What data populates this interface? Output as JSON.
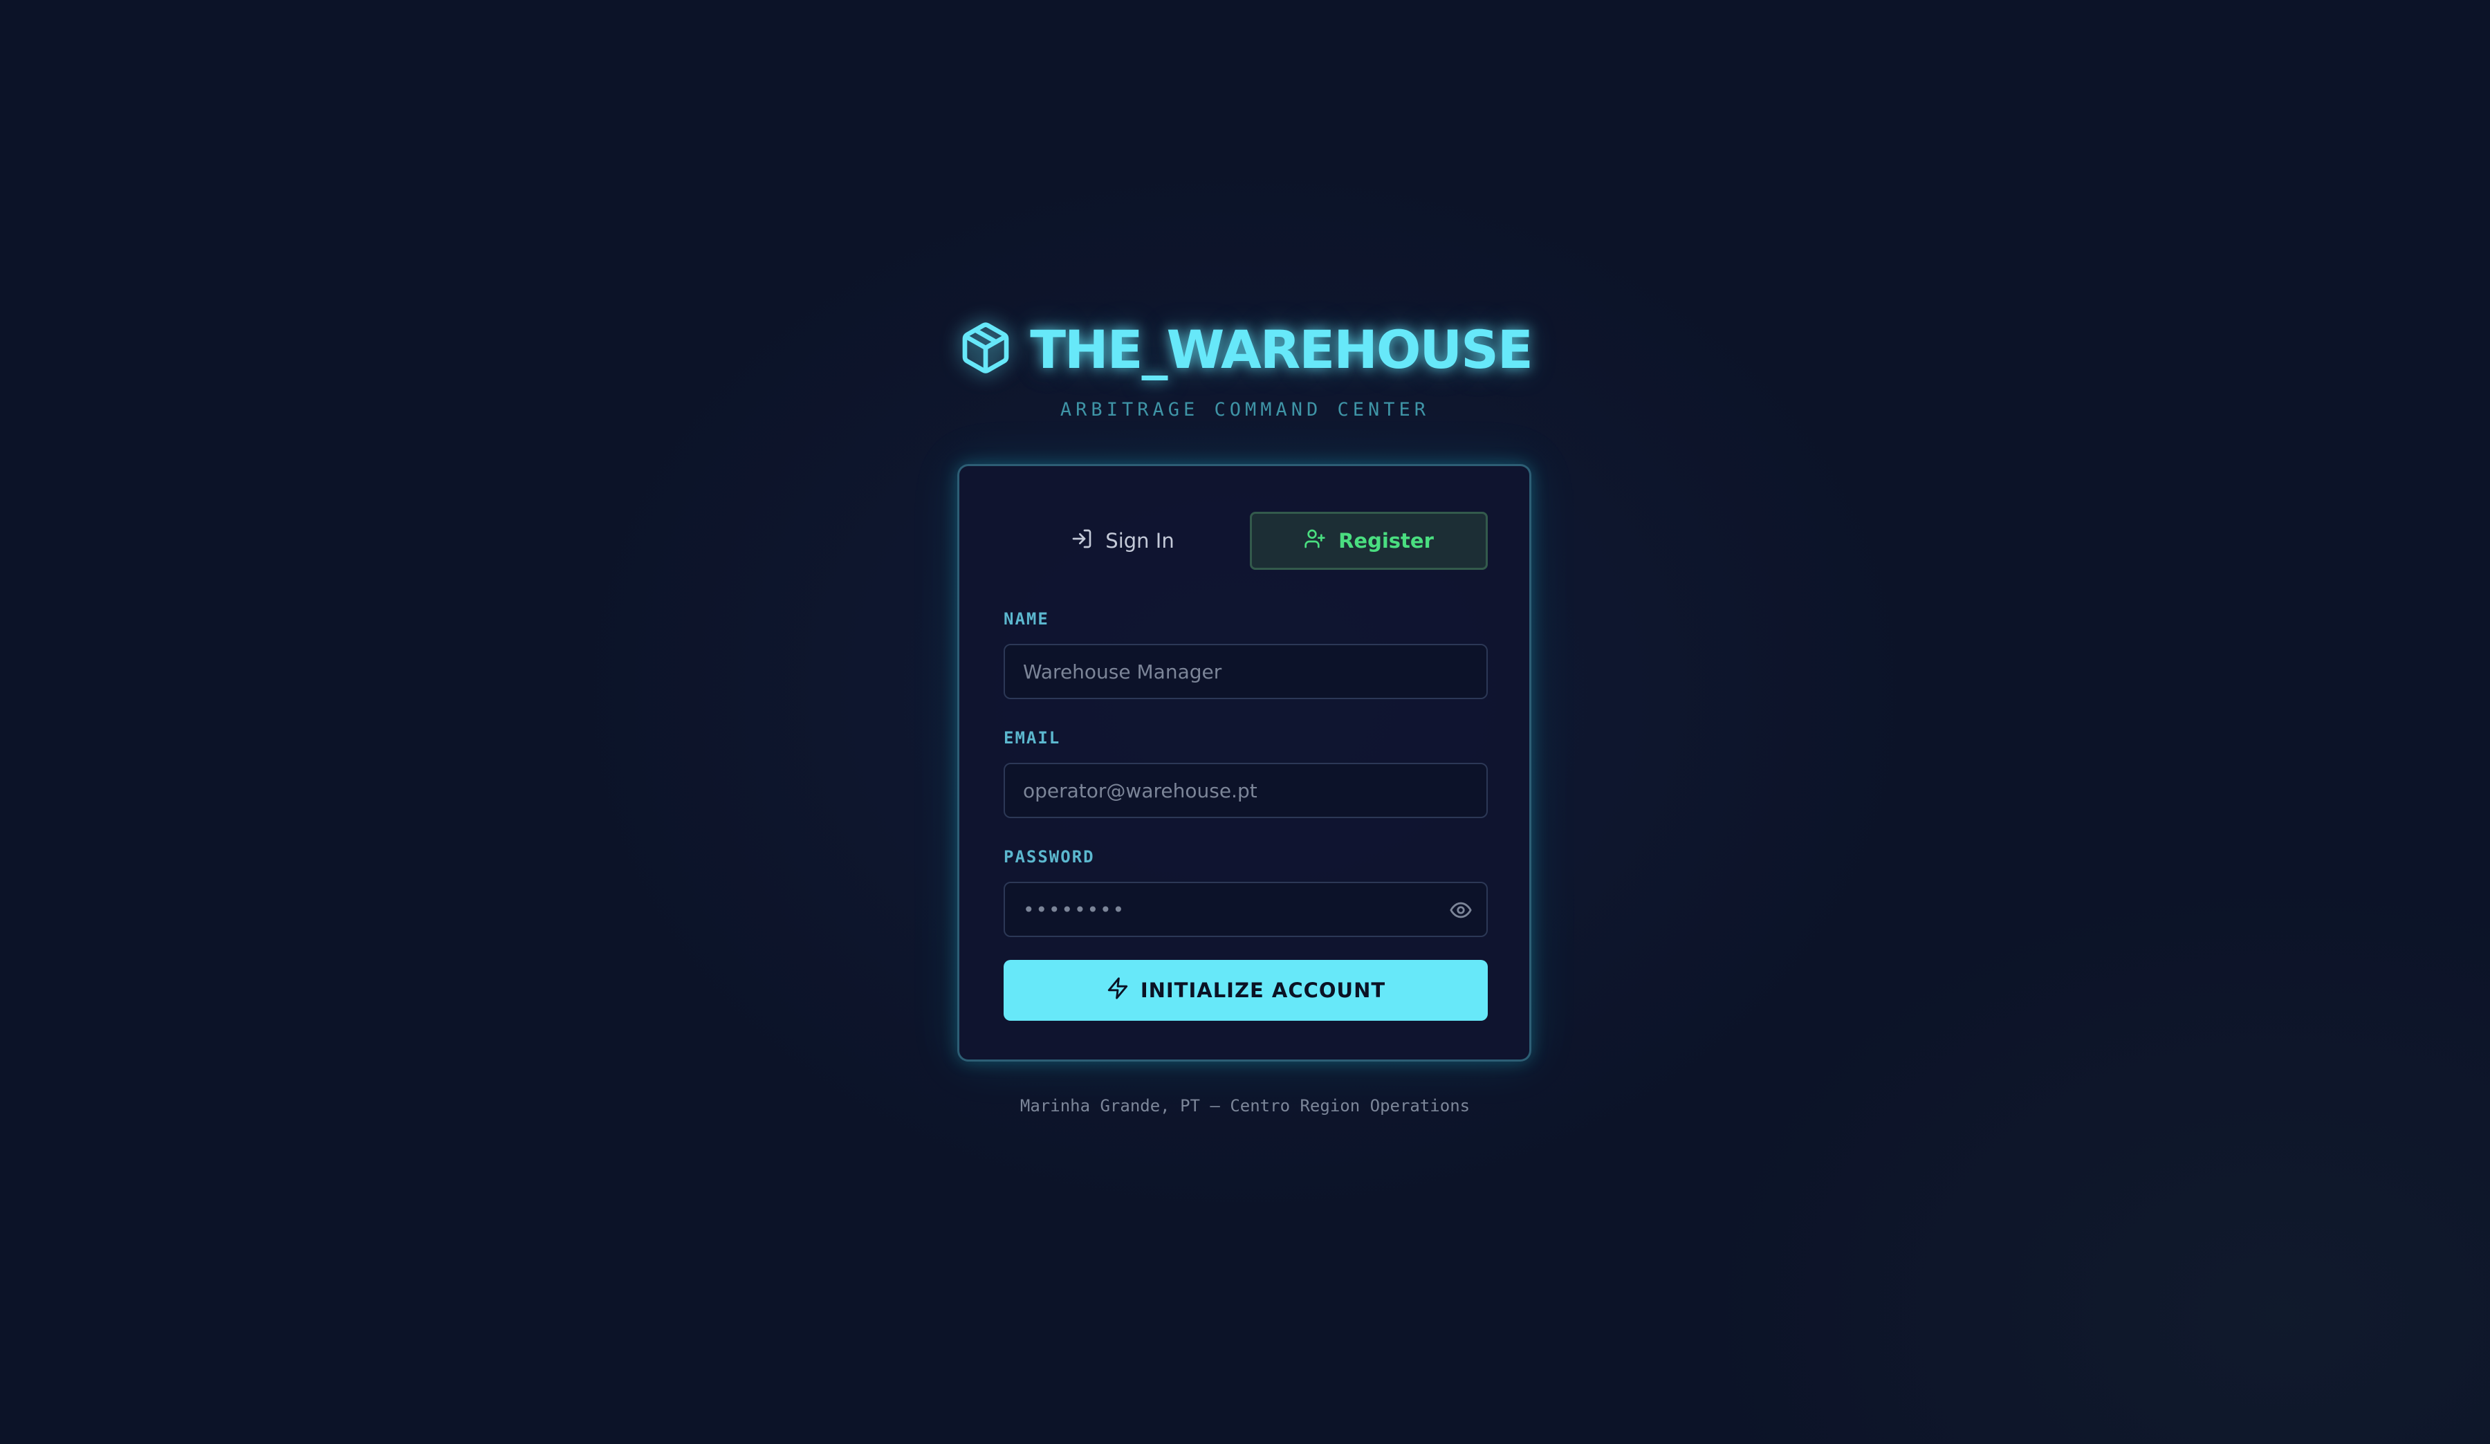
{
  "app": {
    "title": "THE_WAREHOUSE",
    "subtitle": "ARBITRAGE COMMAND CENTER",
    "logo_icon": "package-icon",
    "accent_color": "#67e8f9"
  },
  "auth": {
    "tabs": [
      {
        "label": "Sign In",
        "icon": "log-in-icon",
        "active": false
      },
      {
        "label": "Register",
        "icon": "user-plus-icon",
        "active": true,
        "color": "#4ade80"
      }
    ],
    "fields": {
      "name": {
        "label": "NAME",
        "placeholder": "Warehouse Manager",
        "value": ""
      },
      "email": {
        "label": "EMAIL",
        "placeholder": "operator@warehouse.pt",
        "value": ""
      },
      "password": {
        "label": "PASSWORD",
        "placeholder": "••••••••",
        "value": "",
        "toggle_icon": "eye-icon"
      }
    },
    "submit": {
      "label": "INITIALIZE ACCOUNT",
      "icon": "zap-icon"
    }
  },
  "footer": {
    "text": "Marinha Grande, PT — Centro Region Operations"
  }
}
